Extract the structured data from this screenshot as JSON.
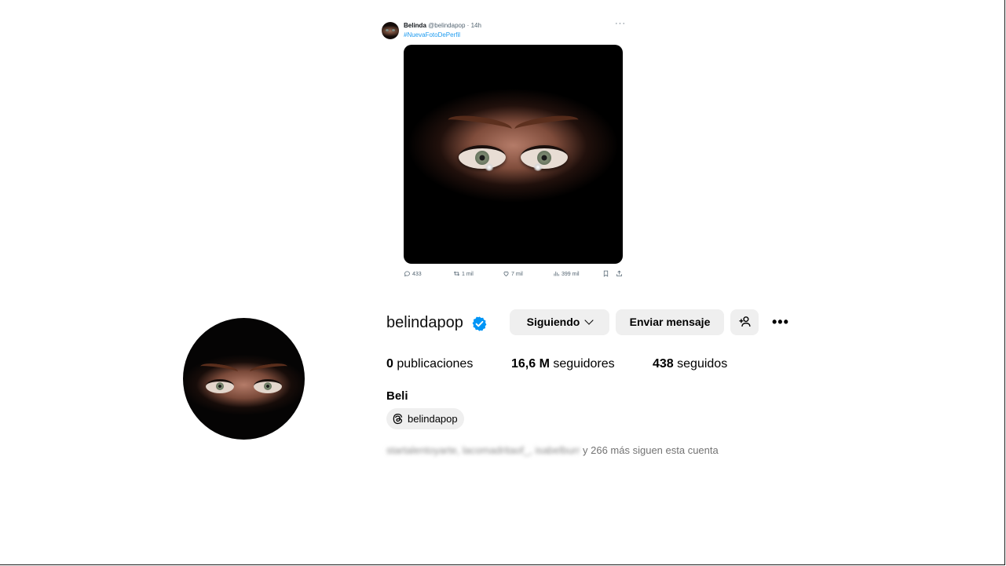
{
  "tweet": {
    "author_name": "Belinda",
    "author_handle": "@belindapop",
    "separator": "·",
    "time": "14h",
    "hashtag": "#NuevaFotoDePerfil",
    "more": "···",
    "stats": {
      "replies": "433",
      "retweets": "1 mil",
      "likes": "7 mil",
      "views": "399 mil"
    }
  },
  "profile": {
    "username": "belindapop",
    "verified": true,
    "following_button": "Siguiendo",
    "message_button": "Enviar mensaje",
    "more": "•••",
    "stats": {
      "posts_count": "0",
      "posts_label": "publicaciones",
      "followers_count": "16,6 M",
      "followers_label": "seguidores",
      "following_count": "438",
      "following_label": "seguidos"
    },
    "full_name": "Beli",
    "threads_handle": "belindapop",
    "followed_by": {
      "names_blurred": "startalentoyarte, lacomadritaof_, isabelburr",
      "suffix": " y 266 más siguen esta cuenta"
    }
  },
  "colors": {
    "link_blue": "#1d9bf0",
    "verified_blue": "#0095f6",
    "button_bg": "#efefef",
    "muted_text": "#737373"
  },
  "icons": [
    "reply-icon",
    "retweet-icon",
    "like-icon",
    "views-icon",
    "bookmark-icon",
    "share-icon",
    "verified-badge-icon",
    "chevron-down-icon",
    "add-person-icon",
    "threads-icon"
  ]
}
